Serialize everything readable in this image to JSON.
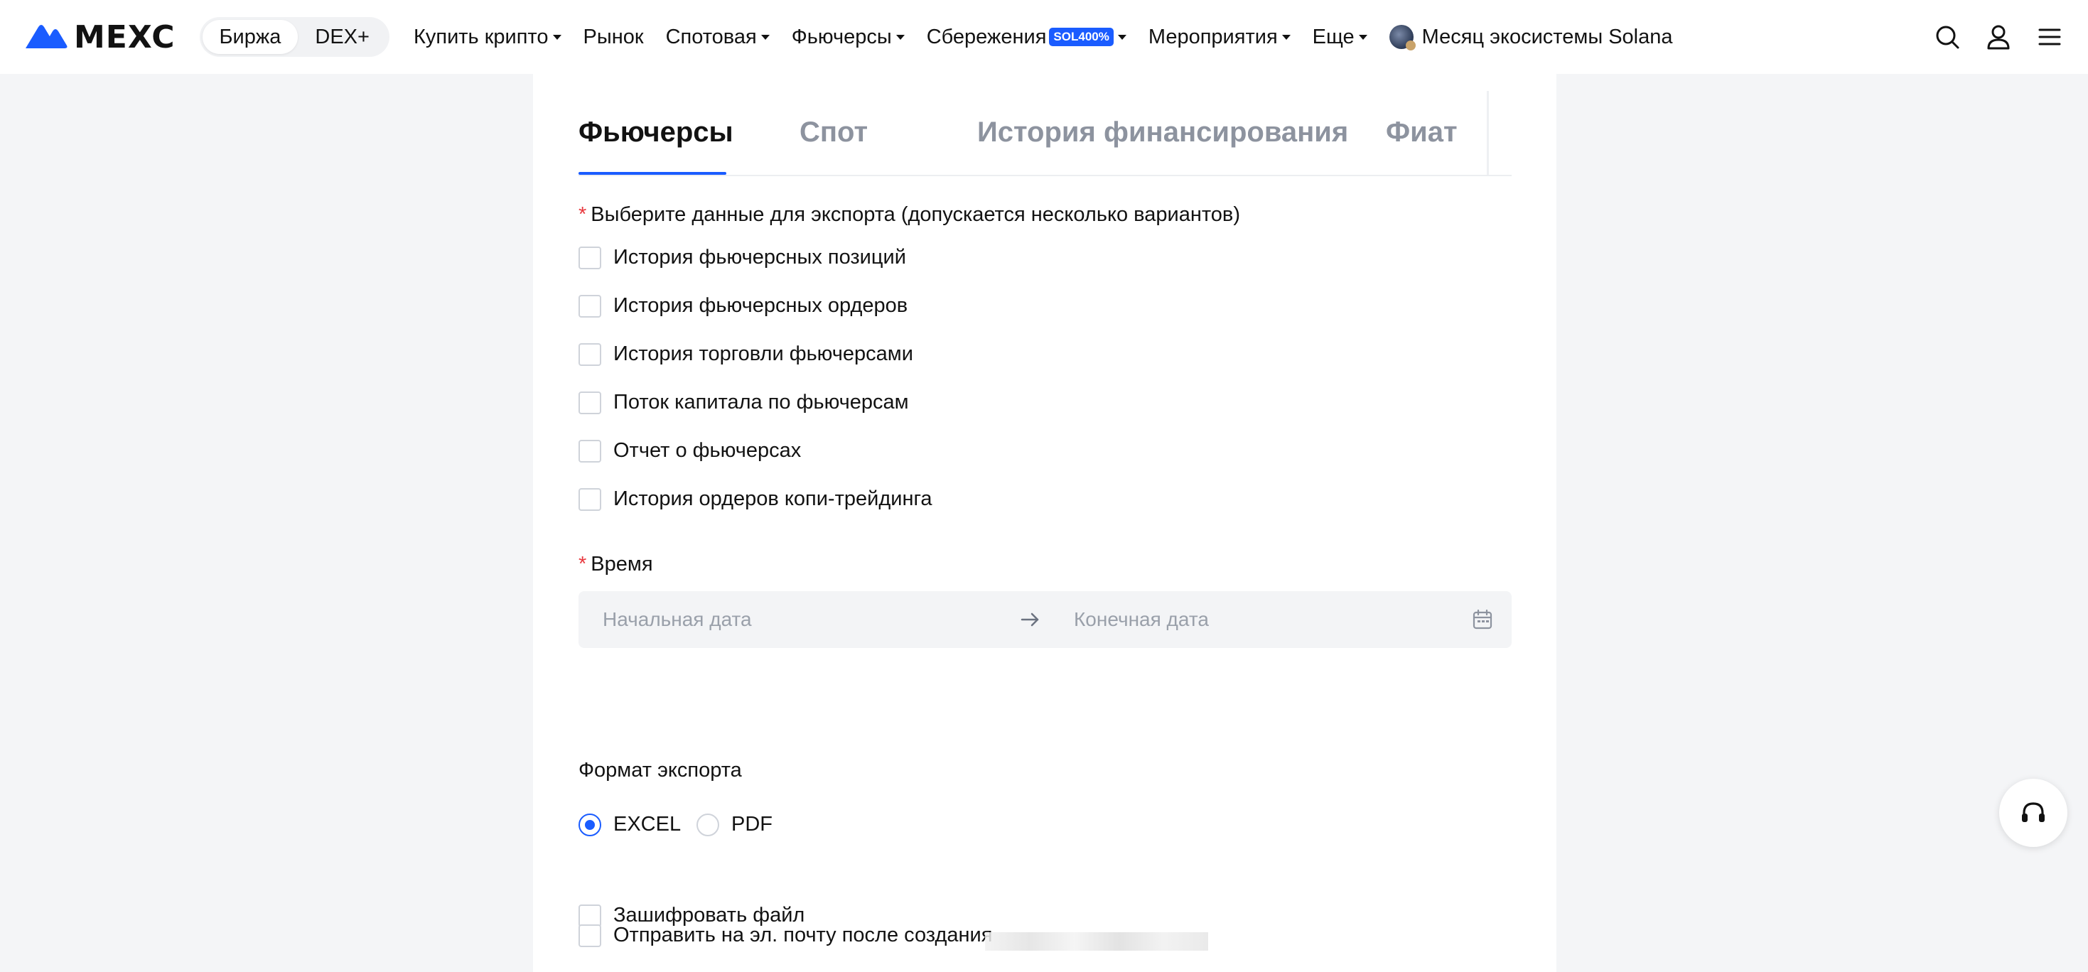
{
  "header": {
    "logo_text": "MEXC",
    "switcher": [
      {
        "label": "Биржа",
        "active": true
      },
      {
        "label": "DEX+",
        "active": false
      }
    ],
    "nav": [
      {
        "label": "Купить крипто",
        "dropdown": true
      },
      {
        "label": "Рынок",
        "dropdown": false
      },
      {
        "label": "Спотовая",
        "dropdown": true
      },
      {
        "label": "Фьючерсы",
        "dropdown": true
      },
      {
        "label": "Сбережения",
        "dropdown": true,
        "badge": "SOL400%"
      },
      {
        "label": "Мероприятия",
        "dropdown": true
      },
      {
        "label": "Еще",
        "dropdown": true
      }
    ],
    "promo": "Месяц экосистемы Solana",
    "icons": [
      "search-icon",
      "user-icon",
      "menu-icon"
    ]
  },
  "tabs": [
    {
      "label": "Фьючерсы",
      "active": true
    },
    {
      "label": "Спот",
      "active": false
    },
    {
      "label": "История финансирования",
      "active": false
    },
    {
      "label": "Фиат",
      "active": false
    }
  ],
  "tabs_more": "···",
  "export": {
    "select_label": "Выберите данные для экспорта (допускается несколько вариантов)",
    "required_mark": "*",
    "options": [
      "История фьючерсных позиций",
      "История фьючерсных ордеров",
      "История торговли фьючерсами",
      "Поток капитала по фьючерсам",
      "Отчет о фьючерсах",
      "История ордеров копи-трейдинга"
    ],
    "time_label": "Время",
    "start_placeholder": "Начальная дата",
    "end_placeholder": "Конечная дата",
    "format_label": "Формат экспорта",
    "formats": [
      {
        "label": "EXCEL",
        "checked": true
      },
      {
        "label": "PDF",
        "checked": false
      }
    ],
    "encrypt_label": "Зашифровать файл",
    "email_label": "Отправить на эл. почту после создания"
  },
  "colors": {
    "accent": "#1a5cff",
    "required": "#e8393f",
    "background": "#f4f5f7"
  },
  "support_icon": "headset-icon"
}
